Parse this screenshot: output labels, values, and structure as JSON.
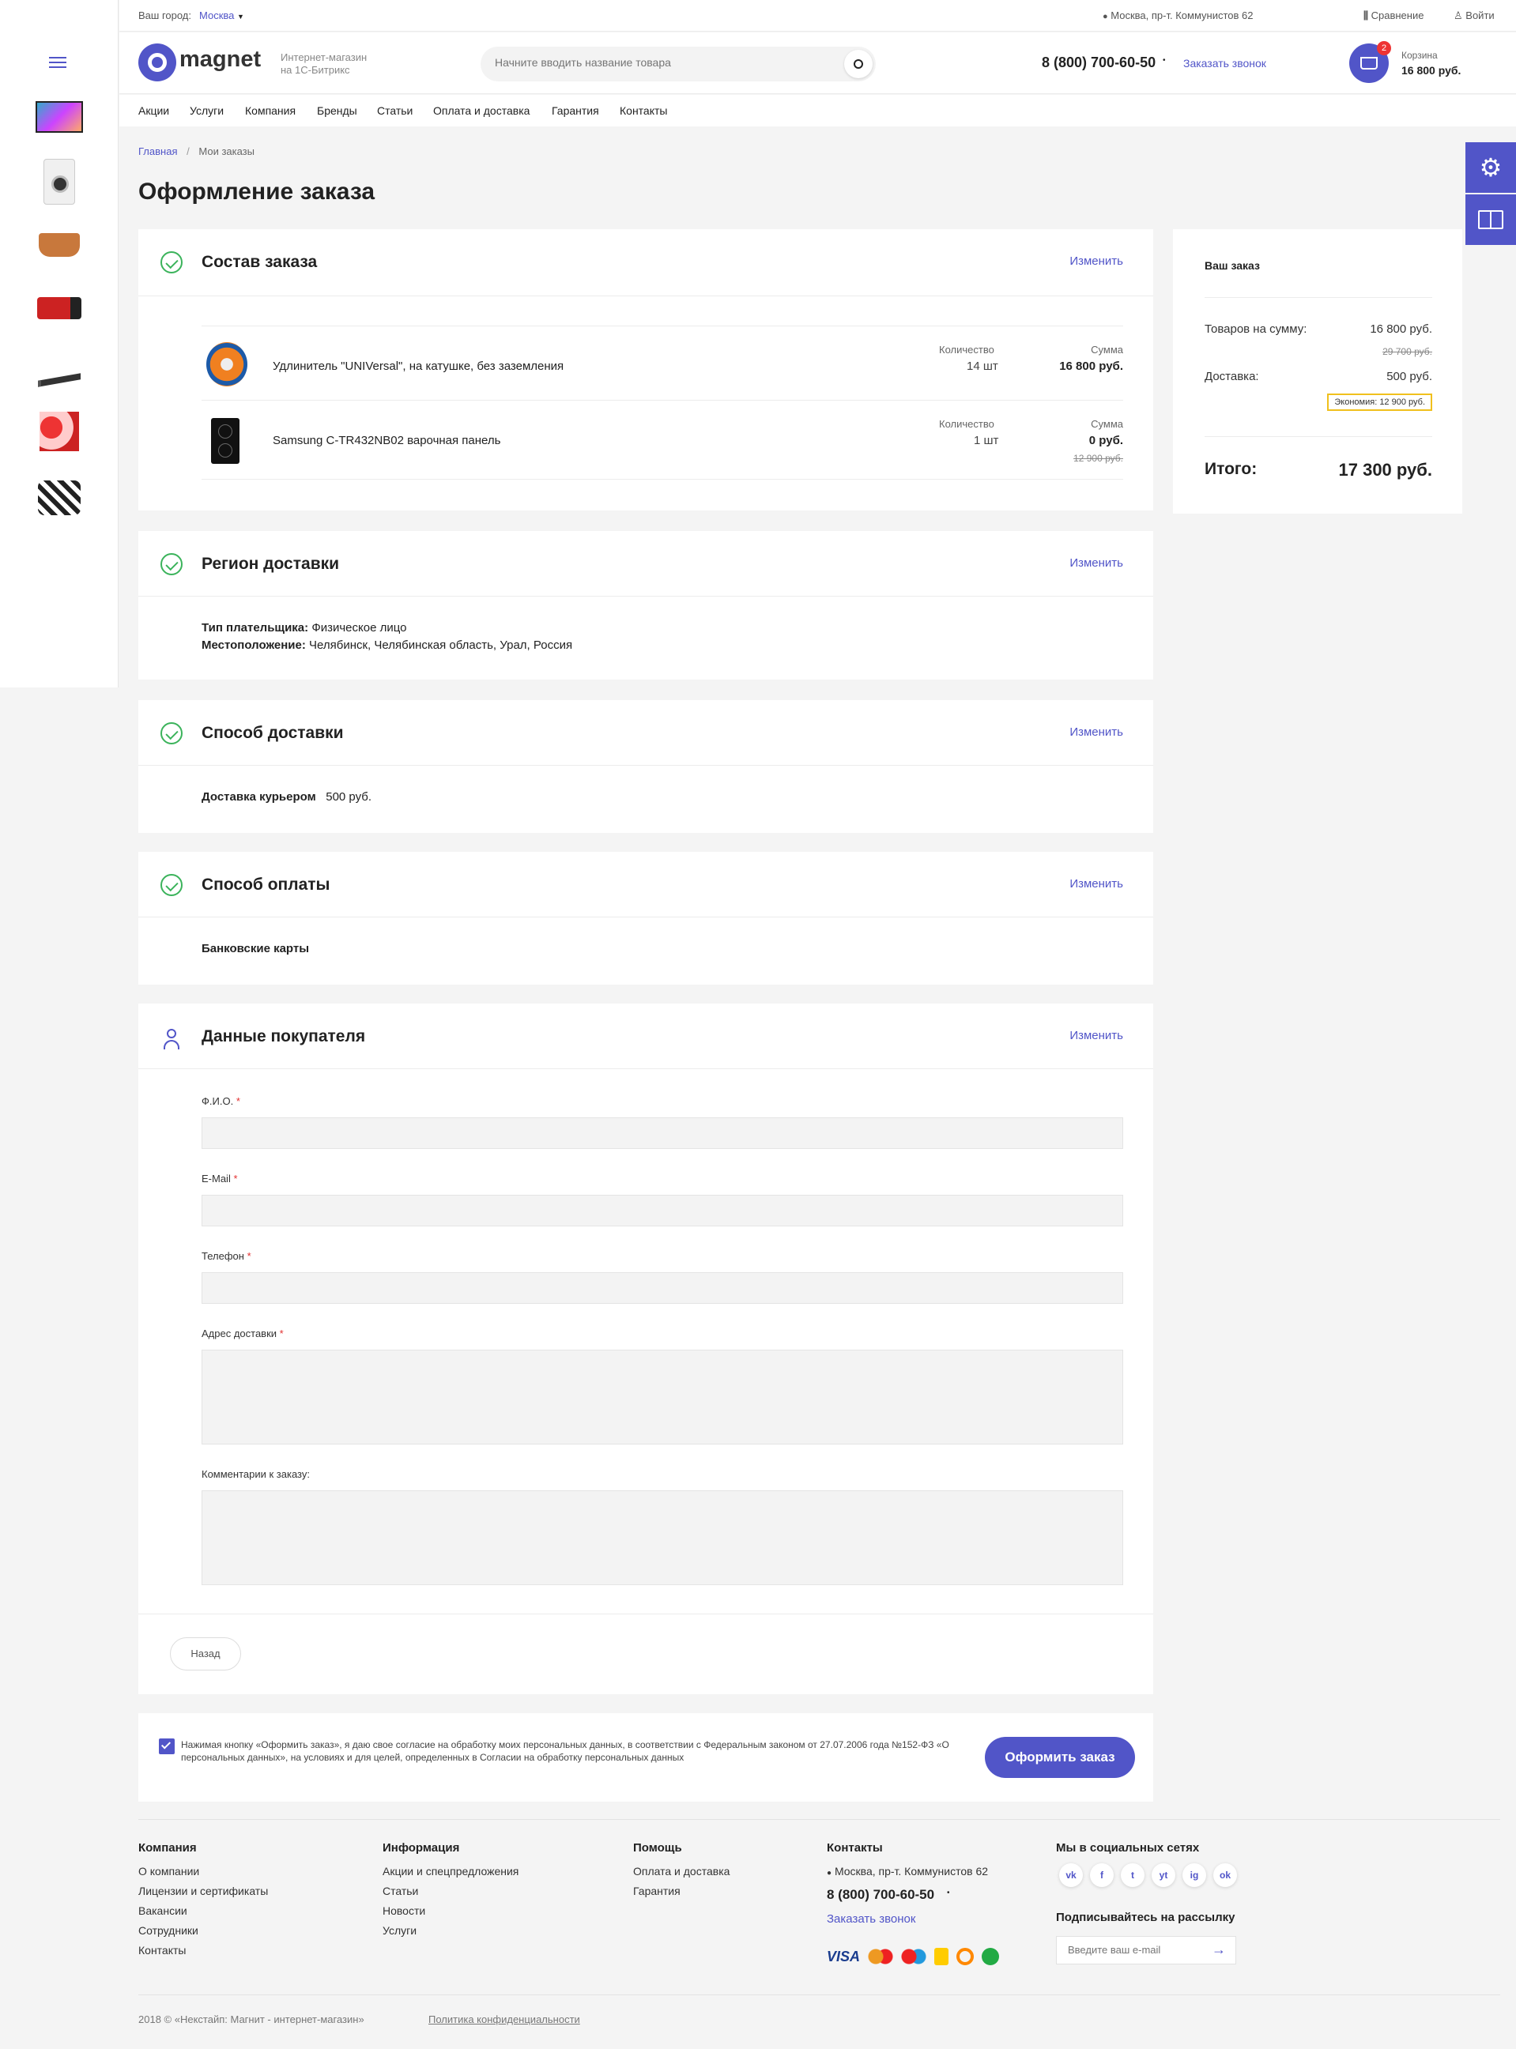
{
  "topbar": {
    "city_label": "Ваш город:",
    "city": "Москва",
    "address": "Москва, пр-т. Коммунистов 62",
    "compare": "Сравнение",
    "login": "Войти"
  },
  "header": {
    "logo": "magnet",
    "tagline1": "Интернет-магазин",
    "tagline2": "на 1С-Битрикс",
    "search_placeholder": "Начните вводить название товара",
    "phone": "8 (800) 700-60-50",
    "callback": "Заказать звонок",
    "cart_label": "Корзина",
    "cart_total": "16 800 руб.",
    "cart_count": "2"
  },
  "nav": [
    "Акции",
    "Услуги",
    "Компания",
    "Бренды",
    "Статьи",
    "Оплата и доставка",
    "Гарантия",
    "Контакты"
  ],
  "breadcrumb": {
    "home": "Главная",
    "sep": "/",
    "current": "Мои заказы"
  },
  "page_title": "Оформление заказа",
  "sections": {
    "order": {
      "title": "Состав заказа",
      "change": "Изменить",
      "items": [
        {
          "name": "Удлинитель \"UNIVersal\", на катушке, без заземления",
          "qty_label": "Количество",
          "qty": "14 шт",
          "sum_label": "Сумма",
          "sum": "16 800 руб.",
          "old": ""
        },
        {
          "name": "Samsung C-TR432NB02 варочная панель",
          "qty_label": "Количество",
          "qty": "1 шт",
          "sum_label": "Сумма",
          "sum": "0 руб.",
          "old": "12 900 руб."
        }
      ]
    },
    "region": {
      "title": "Регион доставки",
      "change": "Изменить",
      "payer_label": "Тип плательщика:",
      "payer": "Физическое лицо",
      "location_label": "Местоположение:",
      "location": "Челябинск, Челябинская область, Урал, Россия"
    },
    "delivery": {
      "title": "Способ доставки",
      "change": "Изменить",
      "method": "Доставка курьером",
      "price": "500 руб."
    },
    "payment": {
      "title": "Способ оплаты",
      "change": "Изменить",
      "method": "Банковские карты"
    },
    "buyer": {
      "title": "Данные покупателя",
      "change": "Изменить",
      "fio": "Ф.И.О.",
      "email": "E-Mail",
      "phone": "Телефон",
      "address": "Адрес доставки",
      "comment": "Комментарии к заказу:",
      "req": "*",
      "back": "Назад"
    }
  },
  "summary": {
    "title": "Ваш заказ",
    "goods_label": "Товаров на сумму:",
    "goods": "16 800 руб.",
    "goods_old": "29 700 руб.",
    "delivery_label": "Доставка:",
    "delivery": "500 руб.",
    "economy": "Экономия: 12 900 руб.",
    "total_label": "Итого:",
    "total": "17 300 руб."
  },
  "consent": {
    "text": "Нажимая кнопку «Оформить заказ», я даю свое согласие на обработку моих персональных данных, в соответствии с Федеральным законом от 27.07.2006 года №152-ФЗ «О персональных данных», на условиях и для целей, определенных в Согласии на обработку персональных данных",
    "submit": "Оформить заказ"
  },
  "footer": {
    "company": {
      "title": "Компания",
      "links": [
        "О компании",
        "Лицензии и сертификаты",
        "Вакансии",
        "Сотрудники",
        "Контакты"
      ]
    },
    "info": {
      "title": "Информация",
      "links": [
        "Акции и спецпредложения",
        "Статьи",
        "Новости",
        "Услуги"
      ]
    },
    "help": {
      "title": "Помощь",
      "links": [
        "Оплата и доставка",
        "Гарантия"
      ]
    },
    "contacts": {
      "title": "Контакты",
      "address": "Москва, пр-т. Коммунистов 62",
      "phone": "8 (800) 700-60-50",
      "callback": "Заказать звонок"
    },
    "social": {
      "title": "Мы в социальных сетях",
      "icons": [
        "vk",
        "f",
        "t",
        "yt",
        "ig",
        "ok"
      ]
    },
    "subscribe": {
      "title": "Подписывайтесь на рассылку",
      "placeholder": "Введите ваш e-mail"
    },
    "payments": [
      "VISA"
    ],
    "copyright": "2018 © «Некстайп: Магнит - интернет-магазин»",
    "policy": "Политика конфиденциальности"
  },
  "colors": {
    "accent": "#5155c8",
    "check": "#3bb35b",
    "economy_border": "#f0c01d"
  }
}
